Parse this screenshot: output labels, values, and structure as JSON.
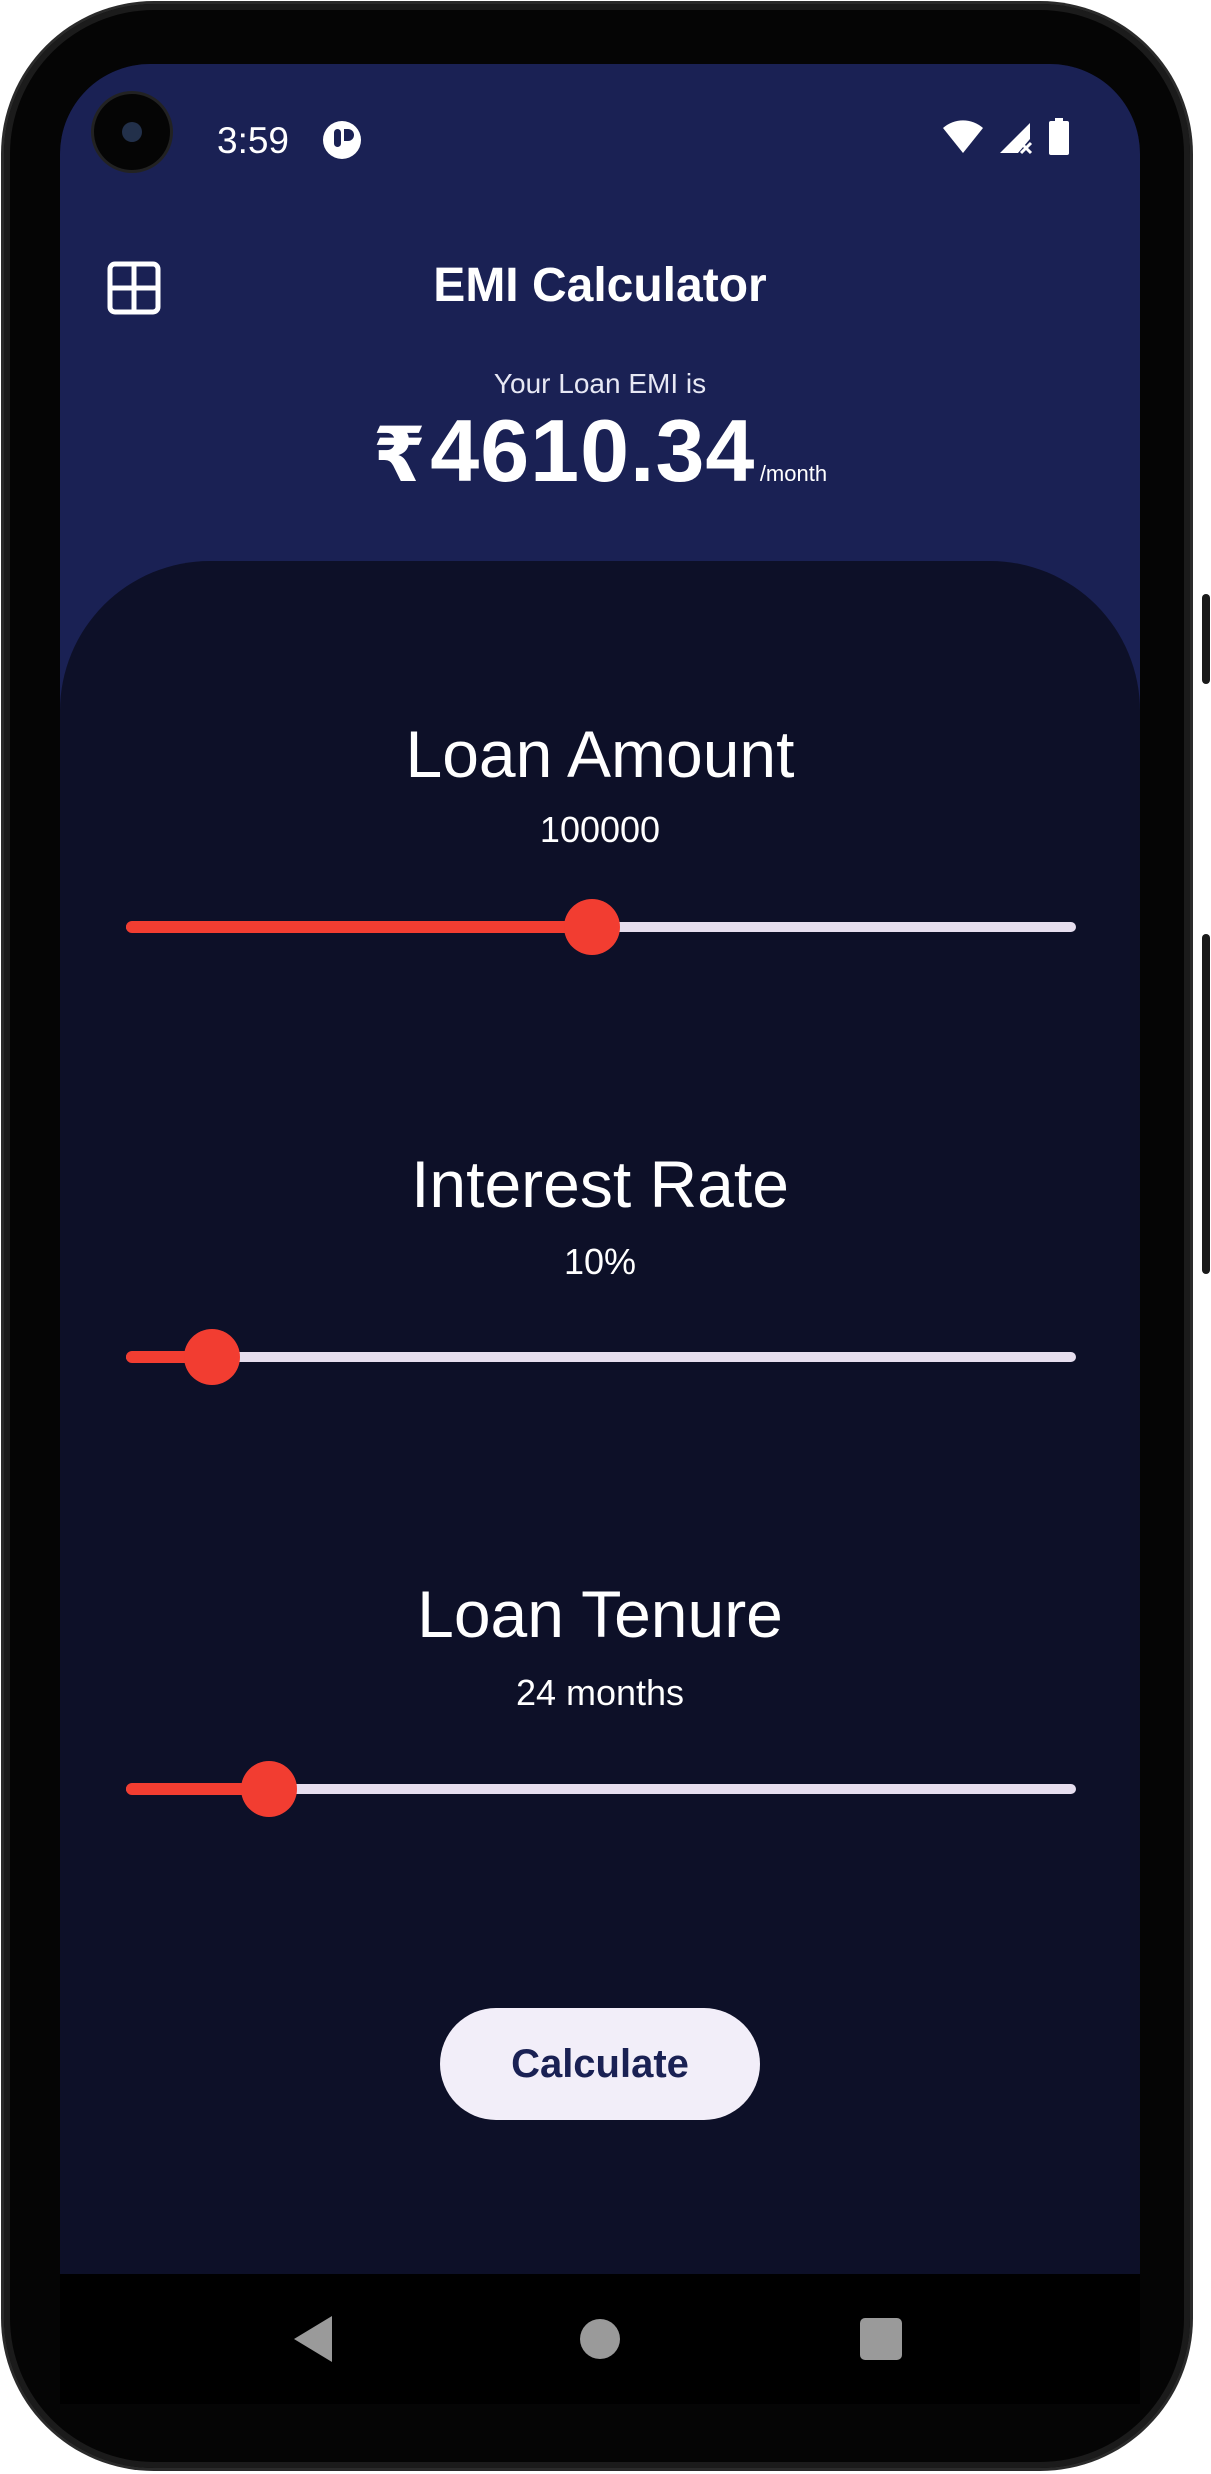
{
  "status_bar": {
    "time": "3:59",
    "app_icon": "notification-app-icon",
    "wifi_icon": "wifi-icon",
    "signal_icon": "signal-icon",
    "battery_icon": "battery-icon"
  },
  "header": {
    "menu_icon": "grid-menu-icon",
    "title": "EMI Calculator",
    "emi_caption": "Your Loan EMI is",
    "currency_symbol": "₹",
    "emi_value": "4610.34",
    "emi_unit": "/month"
  },
  "sections": [
    {
      "title": "Loan Amount",
      "value": "100000",
      "slider_fraction": 0.49
    },
    {
      "title": "Interest Rate",
      "value": "10%",
      "slider_fraction": 0.09
    },
    {
      "title": "Loan Tenure",
      "value": "24 months",
      "slider_fraction": 0.15
    }
  ],
  "calculate_button": {
    "label": "Calculate"
  },
  "navigation": {
    "back_icon": "back-triangle-icon",
    "home_icon": "home-circle-icon",
    "recents_icon": "recents-square-icon"
  },
  "colors": {
    "header_background": "#1a2154",
    "card_background": "#0d1028",
    "accent": "#f23d31",
    "track": "#e6deef",
    "button_background": "#f2eef9",
    "button_text": "#1a2154"
  }
}
